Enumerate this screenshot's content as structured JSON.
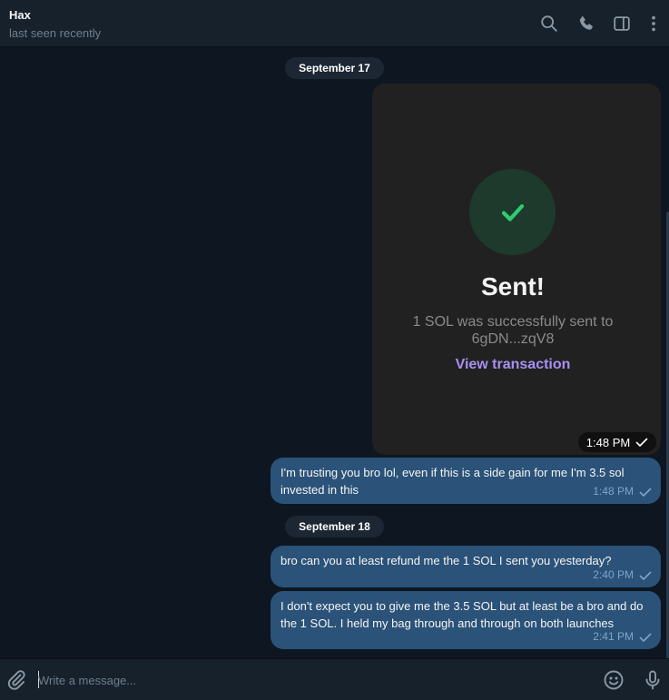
{
  "header": {
    "name": "Hax",
    "status": "last seen recently",
    "icons": [
      "search-icon",
      "phone-icon",
      "sidebar-panel-icon",
      "more-vertical-icon"
    ]
  },
  "chat": {
    "dates": {
      "first": "September 17",
      "second": "September 18"
    },
    "transaction_card": {
      "title": "Sent!",
      "description": "1 SOL was successfully sent to 6gDN...zqV8",
      "link": "View transaction",
      "time": "1:48 PM"
    },
    "messages": [
      {
        "text": "I'm trusting you bro lol, even if this is a side gain for me I'm 3.5 sol invested in this",
        "time": "1:48 PM"
      },
      {
        "text": "bro can you at least refund me the 1 SOL I sent you yesterday?",
        "time": "2:40 PM"
      },
      {
        "text": "I don't expect you to give me the 3.5 SOL but at least be a bro and do the 1 SOL. I held my bag through and through on both launches",
        "time": "2:41 PM"
      }
    ]
  },
  "composer": {
    "placeholder": "Write a message..."
  },
  "colors": {
    "background": "#0e1621",
    "header": "#17212b",
    "outgoing_bubble": "#2b5278",
    "card": "#212121",
    "success_green": "#2ecc71",
    "link_purple": "#a98ff3"
  }
}
